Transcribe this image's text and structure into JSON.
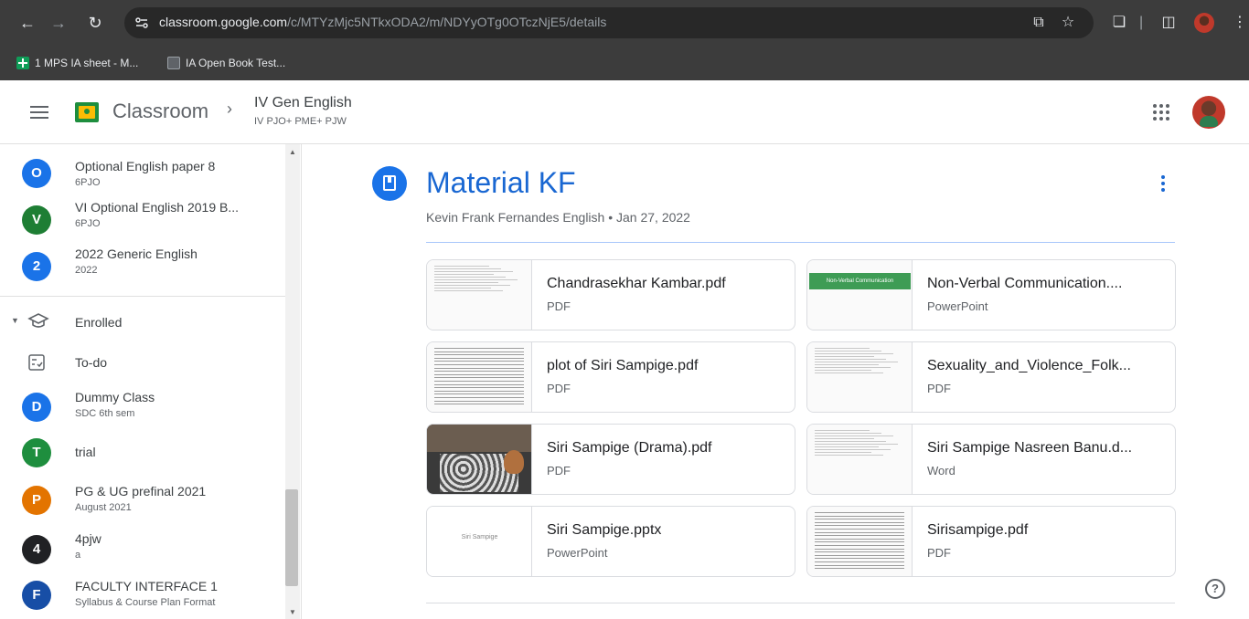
{
  "browser": {
    "url_host": "classroom.google.com",
    "url_path": "/c/MTYzMjc5NTkxODA2/m/NDYyOTg0OTczNjE5/details",
    "bookmarks": [
      {
        "label": "1 MPS IA sheet - M...",
        "icon": "sheets-icon",
        "color": "#0f9d58"
      },
      {
        "label": "IA Open Book Test...",
        "icon": "classroom-icon",
        "color": "#9aa0a6"
      }
    ]
  },
  "header": {
    "app_name": "Classroom",
    "class_name": "IV Gen English",
    "class_section": "IV PJO+ PME+ PJW"
  },
  "sidebar": {
    "classes_top": [
      {
        "initial": "O",
        "name": "Optional English paper 8",
        "sub": "6PJO",
        "color": "#1a73e8"
      },
      {
        "initial": "V",
        "name": "VI Optional English 2019 B...",
        "sub": "6PJO",
        "color": "#1e7e34"
      },
      {
        "initial": "2",
        "name": "2022 Generic English",
        "sub": "2022",
        "color": "#1a73e8"
      }
    ],
    "enrolled_label": "Enrolled",
    "todo_label": "To-do",
    "enrolled_classes": [
      {
        "initial": "D",
        "name": "Dummy Class",
        "sub": "SDC 6th sem",
        "color": "#1a73e8"
      },
      {
        "initial": "T",
        "name": "trial",
        "sub": "",
        "color": "#1e8e3e"
      },
      {
        "initial": "P",
        "name": "PG & UG prefinal 2021",
        "sub": "August 2021",
        "color": "#e37400"
      },
      {
        "initial": "4",
        "name": "4pjw",
        "sub": "a",
        "color": "#202124"
      },
      {
        "initial": "F",
        "name": "FACULTY INTERFACE 1",
        "sub": "Syllabus & Course Plan Format",
        "color": "#174ea6"
      }
    ]
  },
  "material": {
    "title": "Material KF",
    "meta": "Kevin Frank Fernandes English • Jan 27, 2022",
    "attachments": [
      {
        "title": "Chandrasekhar Kambar.pdf",
        "type": "PDF",
        "thumb": "doc"
      },
      {
        "title": "Non-Verbal Communication....",
        "type": "PowerPoint",
        "thumb": "slide-green",
        "thumb_text": "Non-Verbal Communication"
      },
      {
        "title": "plot of Siri Sampige.pdf",
        "type": "PDF",
        "thumb": "doc-dense"
      },
      {
        "title": "Sexuality_and_Violence_Folk...",
        "type": "PDF",
        "thumb": "doc"
      },
      {
        "title": "Siri Sampige (Drama).pdf",
        "type": "PDF",
        "thumb": "book-cover"
      },
      {
        "title": "Siri Sampige Nasreen Banu.d...",
        "type": "Word",
        "thumb": "doc"
      },
      {
        "title": "Siri Sampige.pptx",
        "type": "PowerPoint",
        "thumb": "slide-white",
        "thumb_text": "Siri Sampige"
      },
      {
        "title": "Sirisampige.pdf",
        "type": "PDF",
        "thumb": "doc-dense"
      }
    ]
  }
}
